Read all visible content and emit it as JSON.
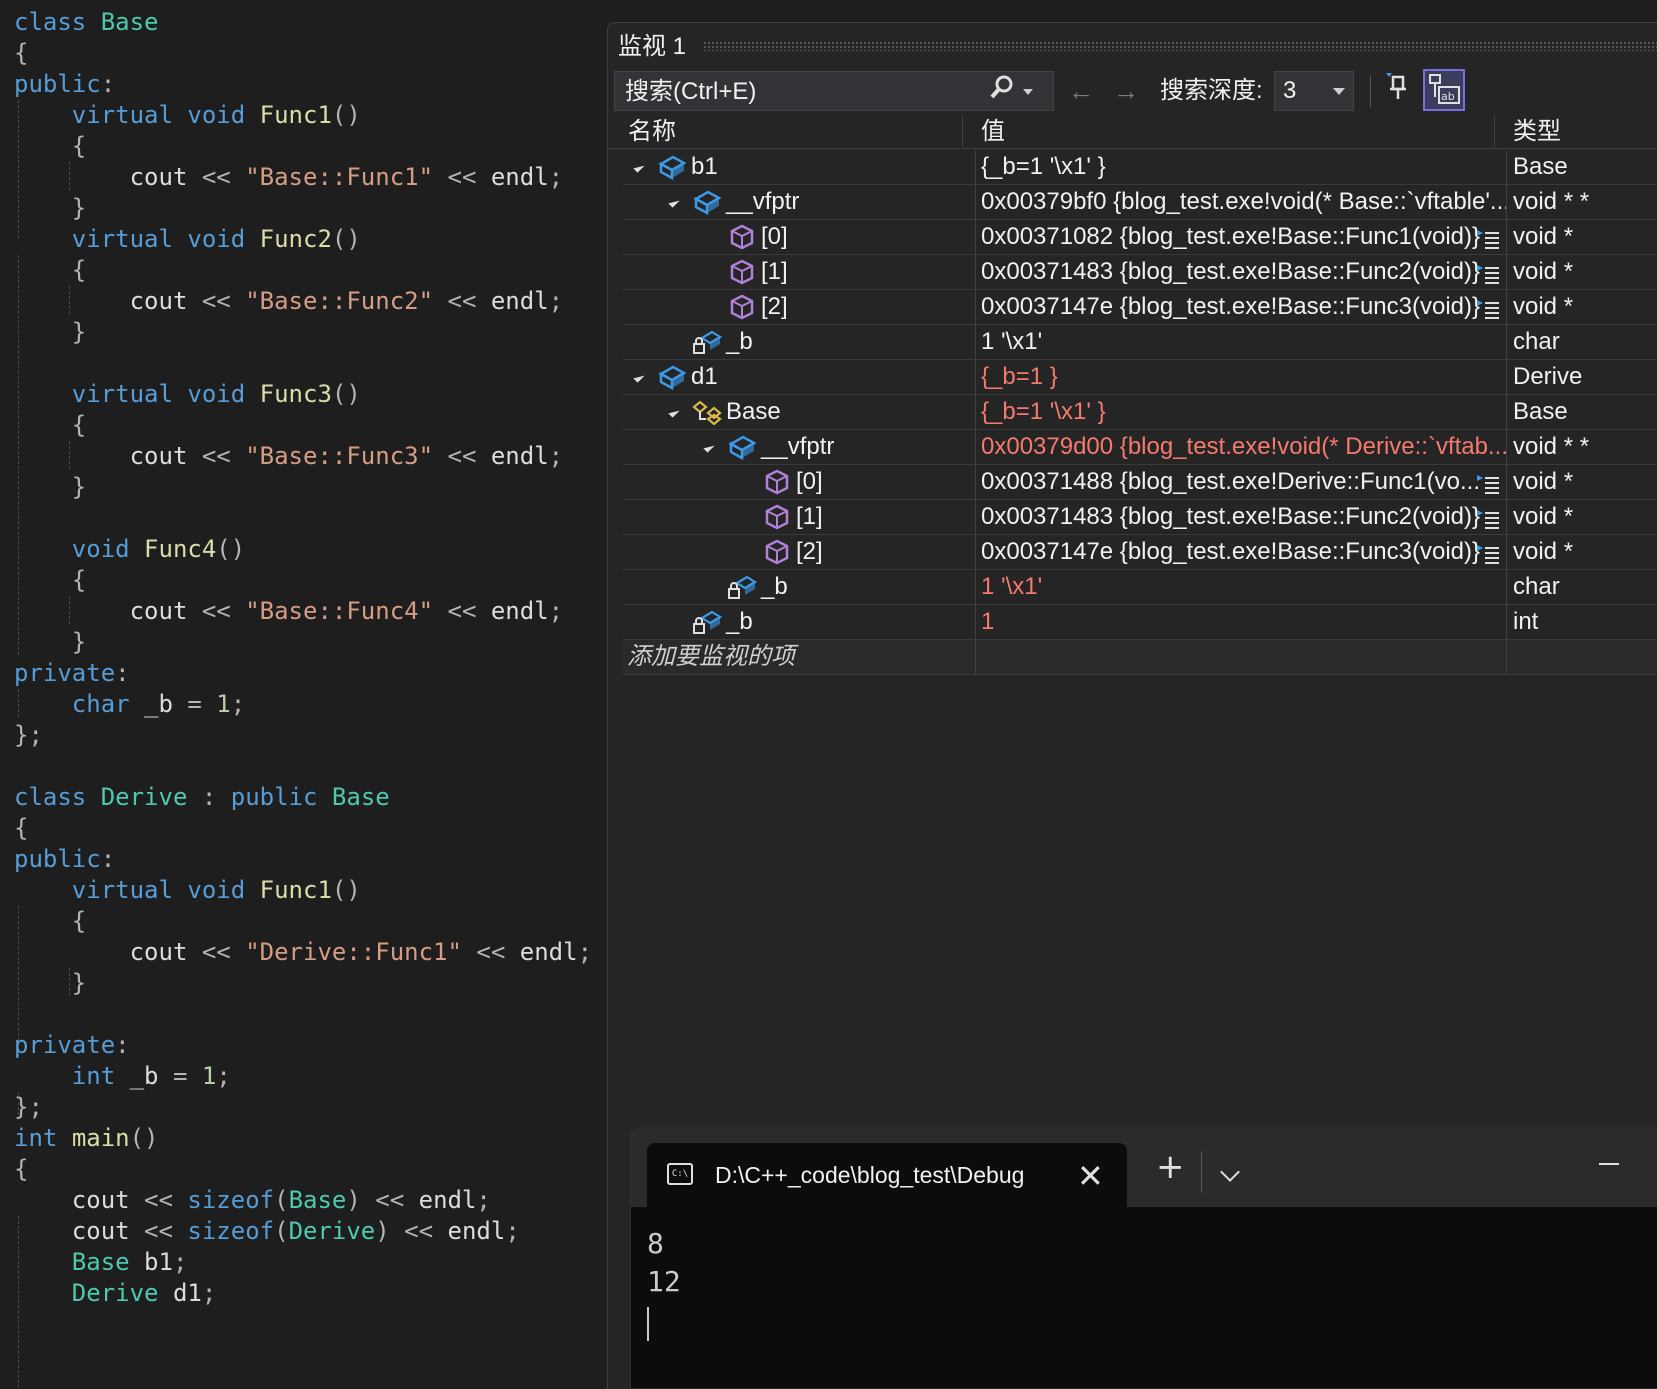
{
  "editor": {
    "lines": [
      [
        [
          "kw",
          "class"
        ],
        [
          "id",
          " "
        ],
        [
          "type",
          "Base"
        ]
      ],
      [
        [
          "punc",
          "{"
        ]
      ],
      [
        [
          "kw",
          "public"
        ],
        [
          "punc",
          ":"
        ]
      ],
      [
        [
          "id",
          "    "
        ],
        [
          "kw",
          "virtual"
        ],
        [
          "id",
          " "
        ],
        [
          "kw",
          "void"
        ],
        [
          "id",
          " "
        ],
        [
          "fn",
          "Func1"
        ],
        [
          "punc",
          "()"
        ]
      ],
      [
        [
          "id",
          "    "
        ],
        [
          "punc",
          "{"
        ]
      ],
      [
        [
          "id",
          "        cout "
        ],
        [
          "punc",
          "<<"
        ],
        [
          "id",
          " "
        ],
        [
          "str",
          "\"Base::Func1\""
        ],
        [
          "id",
          " "
        ],
        [
          "punc",
          "<<"
        ],
        [
          "id",
          " endl"
        ],
        [
          "punc",
          ";"
        ]
      ],
      [
        [
          "id",
          "    "
        ],
        [
          "punc",
          "}"
        ]
      ],
      [
        [
          "id",
          "    "
        ],
        [
          "kw",
          "virtual"
        ],
        [
          "id",
          " "
        ],
        [
          "kw",
          "void"
        ],
        [
          "id",
          " "
        ],
        [
          "fn",
          "Func2"
        ],
        [
          "punc",
          "()"
        ]
      ],
      [
        [
          "id",
          "    "
        ],
        [
          "punc",
          "{"
        ]
      ],
      [
        [
          "id",
          "        cout "
        ],
        [
          "punc",
          "<<"
        ],
        [
          "id",
          " "
        ],
        [
          "str",
          "\"Base::Func2\""
        ],
        [
          "id",
          " "
        ],
        [
          "punc",
          "<<"
        ],
        [
          "id",
          " endl"
        ],
        [
          "punc",
          ";"
        ]
      ],
      [
        [
          "id",
          "    "
        ],
        [
          "punc",
          "}"
        ]
      ],
      [],
      [
        [
          "id",
          "    "
        ],
        [
          "kw",
          "virtual"
        ],
        [
          "id",
          " "
        ],
        [
          "kw",
          "void"
        ],
        [
          "id",
          " "
        ],
        [
          "fn",
          "Func3"
        ],
        [
          "punc",
          "()"
        ]
      ],
      [
        [
          "id",
          "    "
        ],
        [
          "punc",
          "{"
        ]
      ],
      [
        [
          "id",
          "        cout "
        ],
        [
          "punc",
          "<<"
        ],
        [
          "id",
          " "
        ],
        [
          "str",
          "\"Base::Func3\""
        ],
        [
          "id",
          " "
        ],
        [
          "punc",
          "<<"
        ],
        [
          "id",
          " endl"
        ],
        [
          "punc",
          ";"
        ]
      ],
      [
        [
          "id",
          "    "
        ],
        [
          "punc",
          "}"
        ]
      ],
      [],
      [
        [
          "id",
          "    "
        ],
        [
          "kw",
          "void"
        ],
        [
          "id",
          " "
        ],
        [
          "fn",
          "Func4"
        ],
        [
          "punc",
          "()"
        ]
      ],
      [
        [
          "id",
          "    "
        ],
        [
          "punc",
          "{"
        ]
      ],
      [
        [
          "id",
          "        cout "
        ],
        [
          "punc",
          "<<"
        ],
        [
          "id",
          " "
        ],
        [
          "str",
          "\"Base::Func4\""
        ],
        [
          "id",
          " "
        ],
        [
          "punc",
          "<<"
        ],
        [
          "id",
          " endl"
        ],
        [
          "punc",
          ";"
        ]
      ],
      [
        [
          "id",
          "    "
        ],
        [
          "punc",
          "}"
        ]
      ],
      [
        [
          "kw",
          "private"
        ],
        [
          "punc",
          ":"
        ]
      ],
      [
        [
          "id",
          "    "
        ],
        [
          "kw",
          "char"
        ],
        [
          "id",
          " _b "
        ],
        [
          "punc",
          "="
        ],
        [
          "id",
          " "
        ],
        [
          "num",
          "1"
        ],
        [
          "punc",
          ";"
        ]
      ],
      [
        [
          "punc",
          "};"
        ]
      ],
      [],
      [
        [
          "kw",
          "class"
        ],
        [
          "id",
          " "
        ],
        [
          "type",
          "Derive"
        ],
        [
          "id",
          " "
        ],
        [
          "punc",
          ":"
        ],
        [
          "id",
          " "
        ],
        [
          "kw",
          "public"
        ],
        [
          "id",
          " "
        ],
        [
          "type",
          "Base"
        ]
      ],
      [
        [
          "punc",
          "{"
        ]
      ],
      [
        [
          "kw",
          "public"
        ],
        [
          "punc",
          ":"
        ]
      ],
      [
        [
          "id",
          "    "
        ],
        [
          "kw",
          "virtual"
        ],
        [
          "id",
          " "
        ],
        [
          "kw",
          "void"
        ],
        [
          "id",
          " "
        ],
        [
          "fn",
          "Func1"
        ],
        [
          "punc",
          "()"
        ]
      ],
      [
        [
          "id",
          "    "
        ],
        [
          "punc",
          "{"
        ]
      ],
      [
        [
          "id",
          "        cout "
        ],
        [
          "punc",
          "<<"
        ],
        [
          "id",
          " "
        ],
        [
          "str",
          "\"Derive::Func1\""
        ],
        [
          "id",
          " "
        ],
        [
          "punc",
          "<<"
        ],
        [
          "id",
          " endl"
        ],
        [
          "punc",
          ";"
        ]
      ],
      [
        [
          "id",
          "    "
        ],
        [
          "punc",
          "}"
        ]
      ],
      [],
      [
        [
          "kw",
          "private"
        ],
        [
          "punc",
          ":"
        ]
      ],
      [
        [
          "id",
          "    "
        ],
        [
          "kw",
          "int"
        ],
        [
          "id",
          " _b "
        ],
        [
          "punc",
          "="
        ],
        [
          "id",
          " "
        ],
        [
          "num",
          "1"
        ],
        [
          "punc",
          ";"
        ]
      ],
      [
        [
          "punc",
          "};"
        ]
      ],
      [
        [
          "kw",
          "int"
        ],
        [
          "id",
          " "
        ],
        [
          "fn",
          "main"
        ],
        [
          "punc",
          "()"
        ]
      ],
      [
        [
          "punc",
          "{"
        ]
      ],
      [
        [
          "id",
          "    cout "
        ],
        [
          "punc",
          "<<"
        ],
        [
          "id",
          " "
        ],
        [
          "kw",
          "sizeof"
        ],
        [
          "punc",
          "("
        ],
        [
          "type",
          "Base"
        ],
        [
          "punc",
          ")"
        ],
        [
          "id",
          " "
        ],
        [
          "punc",
          "<<"
        ],
        [
          "id",
          " endl"
        ],
        [
          "punc",
          ";"
        ]
      ],
      [
        [
          "id",
          "    cout "
        ],
        [
          "punc",
          "<<"
        ],
        [
          "id",
          " "
        ],
        [
          "kw",
          "sizeof"
        ],
        [
          "punc",
          "("
        ],
        [
          "type",
          "Derive"
        ],
        [
          "punc",
          ")"
        ],
        [
          "id",
          " "
        ],
        [
          "punc",
          "<<"
        ],
        [
          "id",
          " endl"
        ],
        [
          "punc",
          ";"
        ]
      ],
      [
        [
          "id",
          "    "
        ],
        [
          "type",
          "Base"
        ],
        [
          "id",
          " b1"
        ],
        [
          "punc",
          ";"
        ]
      ],
      [
        [
          "id",
          "    "
        ],
        [
          "type",
          "Derive"
        ],
        [
          "id",
          " d1"
        ],
        [
          "punc",
          ";"
        ]
      ]
    ],
    "line_tops": [
      6,
      37,
      68,
      99,
      130,
      161,
      192,
      223,
      254,
      285,
      316,
      347,
      378,
      409,
      440,
      471,
      502,
      533,
      564,
      595,
      626,
      657,
      688,
      719,
      750,
      781,
      812,
      843,
      874,
      905,
      936,
      967,
      998,
      1029,
      1060,
      1091,
      1122,
      1153,
      1184,
      1215,
      1246,
      1277
    ]
  },
  "watch": {
    "title": "监视 1",
    "search_placeholder": "搜索(Ctrl+E)",
    "depth_label": "搜索深度:",
    "depth_value": "3",
    "columns": {
      "name": "名称",
      "value": "值",
      "type": "类型"
    },
    "rows": [
      {
        "name": "b1",
        "value": "{_b=1 '\\x1' }",
        "type": "Base",
        "level": 0,
        "expanded": true,
        "icon": "object-icon",
        "changed": false,
        "visualizer": false
      },
      {
        "name": "__vfptr",
        "value": "0x00379bf0 {blog_test.exe!void(* Base::`vftable'...",
        "type": "void * *",
        "level": 1,
        "expanded": true,
        "icon": "object-icon",
        "changed": false,
        "visualizer": false
      },
      {
        "name": "[0]",
        "value": "0x00371082 {blog_test.exe!Base::Func1(void)}",
        "type": "void *",
        "level": 2,
        "expanded": false,
        "icon": "member-cube-icon",
        "changed": false,
        "visualizer": true
      },
      {
        "name": "[1]",
        "value": "0x00371483 {blog_test.exe!Base::Func2(void)}",
        "type": "void *",
        "level": 2,
        "expanded": false,
        "icon": "member-cube-icon",
        "changed": false,
        "visualizer": true
      },
      {
        "name": "[2]",
        "value": "0x0037147e {blog_test.exe!Base::Func3(void)}",
        "type": "void *",
        "level": 2,
        "expanded": false,
        "icon": "member-cube-icon",
        "changed": false,
        "visualizer": true
      },
      {
        "name": "_b",
        "value": "1 '\\x1'",
        "type": "char",
        "level": 1,
        "expanded": false,
        "icon": "private-field-icon",
        "changed": false,
        "visualizer": false
      },
      {
        "name": "d1",
        "value": "{_b=1 }",
        "type": "Derive",
        "level": 0,
        "expanded": true,
        "icon": "object-icon",
        "changed": true,
        "visualizer": false
      },
      {
        "name": "Base",
        "value": "{_b=1 '\\x1' }",
        "type": "Base",
        "level": 1,
        "expanded": true,
        "icon": "base-class-icon",
        "changed": true,
        "visualizer": false
      },
      {
        "name": "__vfptr",
        "value": "0x00379d00 {blog_test.exe!void(* Derive::`vftab...",
        "type": "void * *",
        "level": 2,
        "expanded": true,
        "icon": "object-icon",
        "changed": true,
        "visualizer": false
      },
      {
        "name": "[0]",
        "value": "0x00371488 {blog_test.exe!Derive::Func1(vo...",
        "type": "void *",
        "level": 3,
        "expanded": false,
        "icon": "member-cube-icon",
        "changed": false,
        "visualizer": true
      },
      {
        "name": "[1]",
        "value": "0x00371483 {blog_test.exe!Base::Func2(void)}",
        "type": "void *",
        "level": 3,
        "expanded": false,
        "icon": "member-cube-icon",
        "changed": false,
        "visualizer": true
      },
      {
        "name": "[2]",
        "value": "0x0037147e {blog_test.exe!Base::Func3(void)}",
        "type": "void *",
        "level": 3,
        "expanded": false,
        "icon": "member-cube-icon",
        "changed": false,
        "visualizer": true
      },
      {
        "name": "_b",
        "value": "1 '\\x1'",
        "type": "char",
        "level": 2,
        "expanded": false,
        "icon": "private-field-icon",
        "changed": true,
        "visualizer": false
      },
      {
        "name": "_b",
        "value": "1",
        "type": "int",
        "level": 1,
        "expanded": false,
        "icon": "private-field-icon",
        "changed": true,
        "visualizer": false
      }
    ],
    "add_item_label": "添加要监视的项",
    "colors": {
      "changed": "#f47a6e",
      "object_icon": "#3c9ae8",
      "cube_icon": "#b180d7",
      "base_icon": "#d8b94a",
      "highlight": "#7b6fe0"
    }
  },
  "terminal": {
    "tab_title": "D:\\C++_code\\blog_test\\Debug",
    "tab_icon_text": "C:\\",
    "output": [
      "8",
      "12"
    ]
  }
}
